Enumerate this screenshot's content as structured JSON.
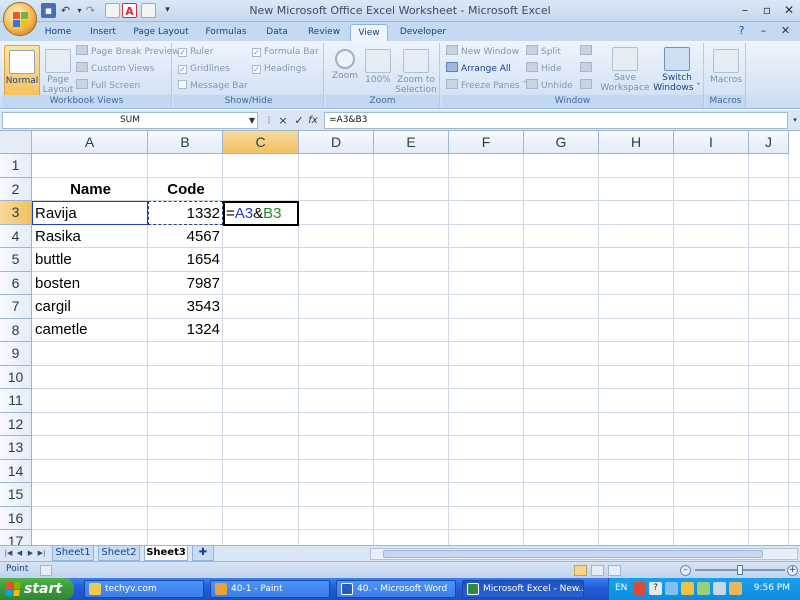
{
  "window": {
    "title": "New Microsoft Office Excel Worksheet - Microsoft Excel",
    "qat_customize": "▾"
  },
  "ribbon_tabs": [
    "Home",
    "Insert",
    "Page Layout",
    "Formulas",
    "Data",
    "Review",
    "View",
    "Developer"
  ],
  "active_tab": "View",
  "ribbon": {
    "workbook_views": {
      "label": "Workbook Views",
      "normal": "Normal",
      "page_layout_l1": "Page",
      "page_layout_l2": "Layout",
      "page_break_preview": "Page Break Preview",
      "custom_views": "Custom Views",
      "full_screen": "Full Screen"
    },
    "show_hide": {
      "label": "Show/Hide",
      "ruler": "Ruler",
      "gridlines": "Gridlines",
      "message_bar": "Message Bar",
      "formula_bar": "Formula Bar",
      "headings": "Headings"
    },
    "zoom": {
      "label": "Zoom",
      "zoom": "Zoom",
      "hundred": "100%",
      "zoom_sel_l1": "Zoom to",
      "zoom_sel_l2": "Selection"
    },
    "window_group": {
      "label": "Window",
      "new_window": "New Window",
      "arrange_all": "Arrange All",
      "freeze_panes": "Freeze Panes ˇ",
      "split": "Split",
      "hide": "Hide",
      "unhide": "Unhide",
      "save_ws_l1": "Save",
      "save_ws_l2": "Workspace",
      "switch_l1": "Switch",
      "switch_l2": "Windows ˇ"
    },
    "macros": {
      "label": "Macros",
      "macros": "Macros"
    }
  },
  "formula_bar": {
    "name_box": "SUM",
    "formula": "=A3&B3",
    "cancel": "×",
    "enter": "✓",
    "fx": "fx"
  },
  "columns": [
    "A",
    "B",
    "C",
    "D",
    "E",
    "F",
    "G",
    "H",
    "I",
    "J"
  ],
  "rows": [
    "1",
    "2",
    "3",
    "4",
    "5",
    "6",
    "7",
    "8",
    "9",
    "10",
    "11",
    "12",
    "13",
    "14",
    "15",
    "16",
    "17"
  ],
  "table": {
    "header_name": "Name",
    "header_code": "Code",
    "data": [
      {
        "name": "Ravija",
        "code": "1332"
      },
      {
        "name": "Rasika",
        "code": "4567"
      },
      {
        "name": "buttle",
        "code": "1654"
      },
      {
        "name": "bosten",
        "code": "7987"
      },
      {
        "name": "cargil",
        "code": "3543"
      },
      {
        "name": "cametle",
        "code": "1324"
      }
    ]
  },
  "editing_cell": {
    "eq": "=",
    "ref1": "A3",
    "amp": "&",
    "ref2": "B3"
  },
  "sheets": [
    "Sheet1",
    "Sheet2",
    "Sheet3"
  ],
  "active_sheet": "Sheet3",
  "status": {
    "mode": "Point"
  },
  "taskbar": {
    "start": "start",
    "tasks": [
      "techyv.com",
      "40-1 - Paint",
      "40. - Microsoft Word",
      "Microsoft Excel - New..."
    ],
    "lang": "EN",
    "clock": "9:56 PM"
  },
  "colors": {
    "ref1": "#1f3fbf",
    "ref2": "#21862a",
    "selected_header": "#f1c15f"
  }
}
